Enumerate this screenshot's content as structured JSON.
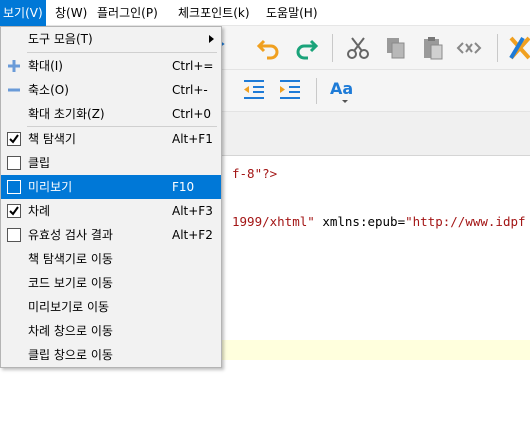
{
  "menubar": {
    "items": [
      {
        "label": "보기(V)"
      },
      {
        "label": "창(W)"
      },
      {
        "label": "플러그인(P)"
      },
      {
        "label": "체크포인트(k)"
      },
      {
        "label": "도움말(H)"
      }
    ]
  },
  "menu": {
    "toolbars": "도구 모음(T)",
    "zoom_in": {
      "label": "확대(I)",
      "shortcut": "Ctrl+="
    },
    "zoom_out": {
      "label": "축소(O)",
      "shortcut": "Ctrl+-"
    },
    "zoom_reset": {
      "label": "확대 초기화(Z)",
      "shortcut": "Ctrl+0"
    },
    "book_browser": {
      "label": "책 탐색기",
      "shortcut": "Alt+F1",
      "checked": true
    },
    "clips": {
      "label": "클립",
      "checked": false
    },
    "preview": {
      "label": "미리보기",
      "shortcut": "F10",
      "checked": false
    },
    "toc": {
      "label": "차례",
      "shortcut": "Alt+F3",
      "checked": true
    },
    "validation": {
      "label": "유효성 검사 결과",
      "shortcut": "Alt+F2",
      "checked": false
    },
    "goto_book_browser": "책 탐색기로 이동",
    "goto_code_view": "코드 보기로 이동",
    "goto_preview": "미리보기로 이동",
    "goto_toc": "차례 창으로 이동",
    "goto_clips": "클립 창으로 이동"
  },
  "editor": {
    "line1": "f-8\"?>",
    "line2_a": "1999/xhtml\"",
    "line2_b": " xmlns:epub=",
    "line2_c": "\"http://www.idpf"
  },
  "toolbar": {
    "font_label": "Aa"
  },
  "colors": {
    "accent": "#0078d7",
    "undo_orange": "#f0a020",
    "redo_green": "#1aa37a",
    "blue_icon": "#1e7bd7"
  }
}
